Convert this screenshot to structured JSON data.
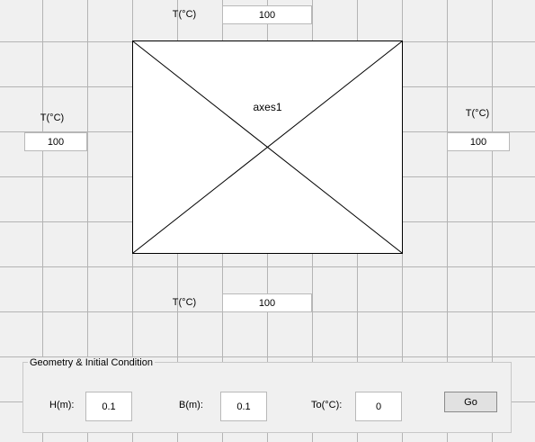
{
  "boundaries": {
    "top": {
      "label": "T(°C)",
      "value": "100"
    },
    "left": {
      "label": "T(°C)",
      "value": "100"
    },
    "right": {
      "label": "T(°C)",
      "value": "100"
    },
    "bottom": {
      "label": "T(°C)",
      "value": "100"
    }
  },
  "axes": {
    "label": "axes1"
  },
  "panel": {
    "title": "Geometry & Initial Condition",
    "height": {
      "label": "H(m):",
      "value": "0.1"
    },
    "breadth": {
      "label": "B(m):",
      "value": "0.1"
    },
    "initial": {
      "label": "To(°C):",
      "value": "0"
    },
    "go_label": "Go"
  }
}
